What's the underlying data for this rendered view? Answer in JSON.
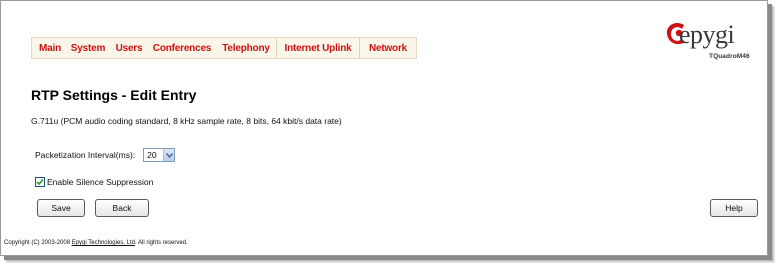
{
  "nav": {
    "items": [
      {
        "label": "Main"
      },
      {
        "label": "System"
      },
      {
        "label": "Users"
      },
      {
        "label": "Conferences"
      },
      {
        "label": "Telephony"
      },
      {
        "label": "Internet Uplink"
      },
      {
        "label": "Network"
      }
    ]
  },
  "logo": {
    "brand": "epygi",
    "model": "TQuadroM46",
    "icon": "epygi-logo-mark"
  },
  "page": {
    "title": "RTP Settings - Edit Entry",
    "description": "G.711u (PCM audio coding standard, 8 kHz sample rate, 8 bits, 64 kbit/s data rate)"
  },
  "form": {
    "packetization_label": "Packetization Interval(ms):",
    "packetization_value": "20",
    "silence_suppression_label": "Enable Silence Suppression",
    "silence_suppression_checked": true
  },
  "buttons": {
    "save": "Save",
    "back": "Back",
    "help": "Help"
  },
  "footer": {
    "prefix": "Copyright (C) 2003-2008 ",
    "link": "Epygi Technologies, Ltd",
    "suffix": ". All rights reserved."
  },
  "colors": {
    "nav_text": "#cc1111",
    "logo_red": "#cc1111",
    "nav_bg": "#fbf6ea"
  }
}
